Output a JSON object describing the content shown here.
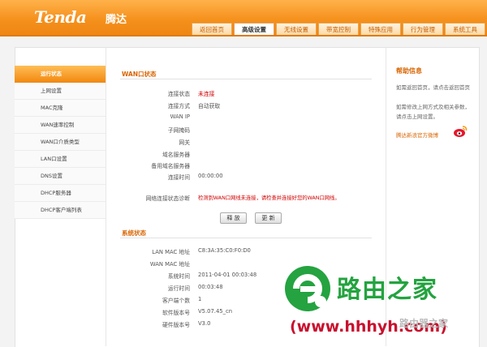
{
  "header": {
    "logo": "Tenda",
    "logo_cn": "腾达",
    "tabs": [
      "返回首页",
      "高级设置",
      "无线设置",
      "带宽控制",
      "特殊应用",
      "行为管理",
      "系统工具"
    ],
    "active_tab": "高级设置"
  },
  "sidebar": {
    "items": [
      "运行状态",
      "上网设置",
      "MAC克隆",
      "WAN速率控制",
      "WAN口介质类型",
      "LAN口设置",
      "DNS设置",
      "DHCP服务器",
      "DHCP客户端列表"
    ],
    "active": "运行状态"
  },
  "wan_status": {
    "title": "WAN口状态",
    "rows": [
      {
        "label": "连接状态",
        "value": "未连接"
      },
      {
        "label": "连接方式",
        "value": "自动获取"
      },
      {
        "label": "WAN IP",
        "value": ""
      },
      {
        "label": "子网掩码",
        "value": ""
      },
      {
        "label": "网关",
        "value": ""
      },
      {
        "label": "域名服务器",
        "value": ""
      },
      {
        "label": "备用域名服务器",
        "value": ""
      },
      {
        "label": "连接时间",
        "value": "00:00:00"
      }
    ],
    "diagnosis_label": "网络连接状态诊断",
    "diagnosis_value": "检测到WAN口网线未连接，请检查并连接好您的WAN口网线。",
    "release_button": "释 放",
    "renew_button": "更 新"
  },
  "system_status": {
    "title": "系统状态",
    "rows": [
      {
        "label": "LAN MAC 地址",
        "value": "C8:3A:35:C0:F0:D0"
      },
      {
        "label": "WAN MAC 地址",
        "value": ""
      },
      {
        "label": "系统时间",
        "value": "2011-04-01 00:03:48"
      },
      {
        "label": "运行时间",
        "value": "00:03:48"
      },
      {
        "label": "客户端个数",
        "value": "1"
      },
      {
        "label": "软件版本号",
        "value": "V5.07.45_cn"
      },
      {
        "label": "硬件版本号",
        "value": "V3.0"
      }
    ]
  },
  "help": {
    "title": "帮助信息",
    "text1": "如需返回首页，请点击返回首页",
    "text2": "如需修改上网方式及相关参数，请点击上网设置。",
    "weibo_link": "腾达新浪官方微博"
  },
  "watermark": {
    "cn": "路由之家",
    "url": "(www.hhhyh.com)",
    "side": "路由器之家"
  },
  "colors": {
    "accent": "#f5901c",
    "title": "#d86400",
    "error": "#d00000"
  }
}
